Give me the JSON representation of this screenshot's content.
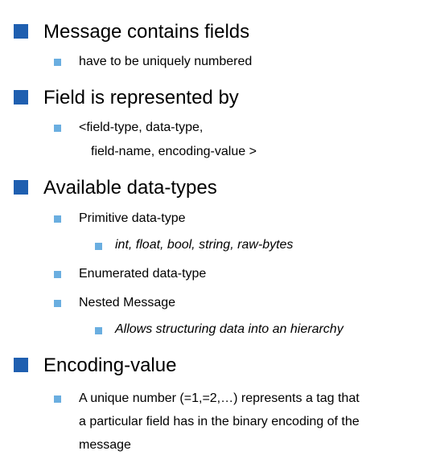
{
  "colors": {
    "level1_bullet": "#1f5fb0",
    "level2_bullet": "#6aaee0",
    "text": "#000000"
  },
  "bullets": [
    {
      "text": "Message contains fields"
    },
    {
      "text": "have to be uniquely numbered"
    },
    {
      "text": "Field is represented by"
    },
    {
      "text": "<field-type, data-type,",
      "continuation": "field-name, encoding-value >"
    },
    {
      "text": "Available data-types"
    },
    {
      "text": "Primitive data-type"
    },
    {
      "text": "int, float, bool, string, raw-bytes"
    },
    {
      "text": "Enumerated data-type"
    },
    {
      "text": "Nested Message"
    },
    {
      "text": "Allows structuring data into an hierarchy"
    },
    {
      "text": "Encoding-value"
    },
    {
      "lines": [
        "A unique number (=1,=2,…) represents a tag that",
        "a particular field has in the binary encoding of the",
        "message"
      ]
    }
  ]
}
